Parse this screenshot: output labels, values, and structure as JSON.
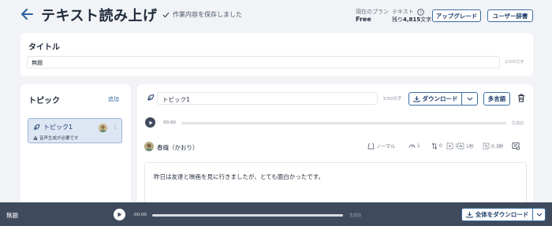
{
  "header": {
    "title": "テキスト読み上げ",
    "save_status": "作業内容を保存しました",
    "plan_label": "現在のプラン",
    "plan_value": "Free",
    "text_label": "テキスト",
    "text_remaining_prefix": "残り",
    "text_remaining_value": "4,815",
    "text_remaining_suffix": "文字",
    "upgrade_label": "アップグレード",
    "dictionary_label": "ユーザー辞書"
  },
  "title_section": {
    "label": "タイトル",
    "value": "無題",
    "char_count": "2/100文字"
  },
  "topics": {
    "heading": "トピック",
    "add_label": "追加",
    "items": [
      {
        "name": "トピック1",
        "warning": "音声生成が必要です"
      }
    ]
  },
  "editor": {
    "topic_name": "トピック1",
    "char_count": "5/50文字",
    "download_label": "ダウンロード",
    "multilang_label": "多言語",
    "player": {
      "time": "00:00",
      "status": "生成前"
    },
    "voice": {
      "name": "春織（かおり）",
      "style": "ノーマル",
      "speed": "1",
      "pitch": "0",
      "volume": "1",
      "pause_before": "1秒",
      "pause_after": "0.3秒"
    },
    "script_text": "昨日は友達と映画を見に行きましたが、とても面白かったです。"
  },
  "bottom_bar": {
    "title": "無題",
    "time": "00:00",
    "status": "生成前",
    "download_all_label": "全体をダウンロード"
  },
  "colors": {
    "accent": "#3b6ea5",
    "dark": "#3f4a5c",
    "background": "#f1f3f6",
    "selected": "#dde6f3"
  }
}
